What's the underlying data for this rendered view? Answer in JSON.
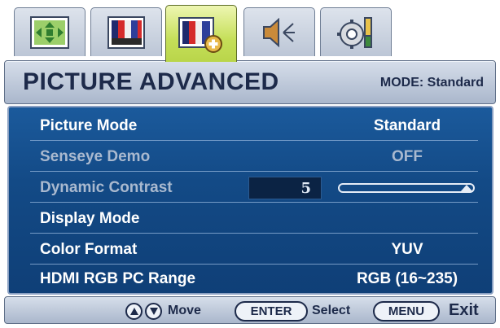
{
  "tabs": [
    {
      "name": "display-tab",
      "icon": "display-arrows-icon"
    },
    {
      "name": "picture-tab",
      "icon": "color-bars-icon"
    },
    {
      "name": "picture-advanced-tab",
      "icon": "color-bars-plus-icon",
      "active": true
    },
    {
      "name": "audio-tab",
      "icon": "speaker-icon"
    },
    {
      "name": "system-tab",
      "icon": "gear-screwdriver-icon"
    }
  ],
  "header": {
    "title": "PICTURE ADVANCED",
    "mode": "MODE: Standard"
  },
  "menu": {
    "items": [
      {
        "label": "Picture Mode",
        "value": "Standard"
      },
      {
        "label": "Senseye Demo",
        "value": "OFF"
      },
      {
        "label": "Dynamic Contrast",
        "value": "5",
        "slider_fraction": 0.97
      },
      {
        "label": "Display Mode",
        "value": ""
      },
      {
        "label": "Color Format",
        "value": "YUV"
      },
      {
        "label": "HDMI RGB PC Range",
        "value": "RGB (16~235)"
      }
    ]
  },
  "footer": {
    "move_label": "Move",
    "enter_button": "ENTER",
    "select_label": "Select",
    "menu_button": "MENU",
    "exit_label": "Exit"
  },
  "colors": {
    "panel_blue": "#134a86",
    "active_tab_green": "#c5df59",
    "bar_grey_blue": "#aab7cc",
    "dim_text": "#a9b9cf"
  }
}
